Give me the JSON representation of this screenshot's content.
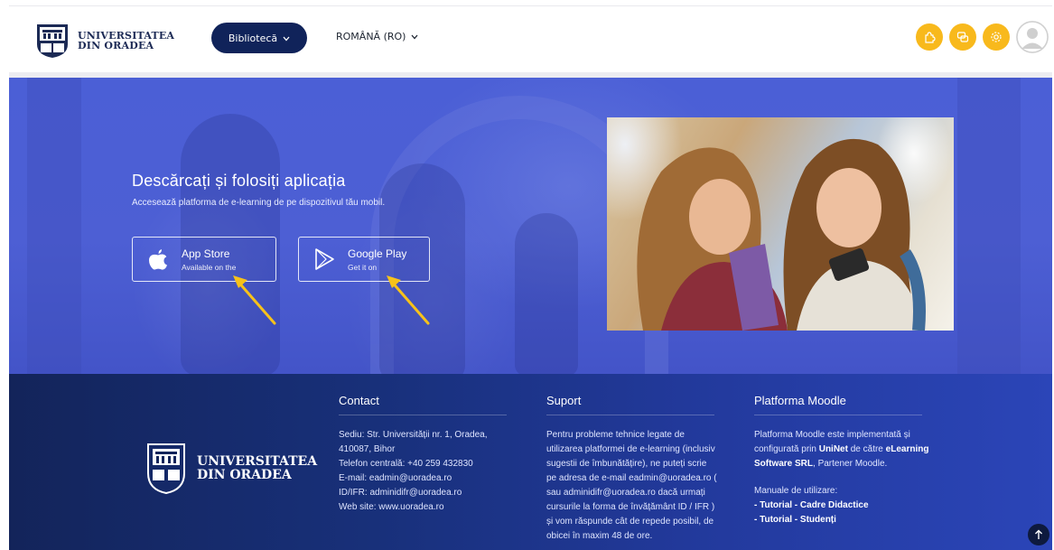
{
  "brand": {
    "line1": "UNIVERSITATEA",
    "line2": "DIN ORADEA"
  },
  "nav": {
    "library_label": "Bibliotecă",
    "language_label": "ROMÂNĂ (RO)",
    "icons": [
      "puzzle-icon",
      "chat-icon",
      "settings-icon"
    ],
    "accent_color": "#f8b91c",
    "nav_button_color": "#10235a"
  },
  "hero": {
    "title": "Descărcați și folosiți aplicația",
    "subtitle": "Accesează platforma de e-learning de pe dispozitivul tău mobil.",
    "app_store": {
      "name": "App Store",
      "small": "Available on the"
    },
    "google_play": {
      "name": "Google Play",
      "small": "Get it on"
    },
    "background_color": "#4b5fd6",
    "annotation_color": "#f7c21a"
  },
  "footer": {
    "logo_line1": "UNIVERSITATEA",
    "logo_line2": "DIN ORADEA",
    "contact": {
      "title": "Contact",
      "lines": [
        "Sediu: Str. Universității nr. 1, Oradea,",
        "410087, Bihor",
        "Telefon centrală: +40 259 432830",
        "E-mail: eadmin@uoradea.ro",
        "ID/IFR: adminidifr@uoradea.ro",
        "Web site: www.uoradea.ro"
      ]
    },
    "support": {
      "title": "Suport",
      "lines": [
        "Pentru probleme tehnice legate de",
        "utilizarea platformei de e-learning (inclusiv",
        "sugestii de îmbunătățire), ne puteți scrie",
        "pe adresa de e-mail eadmin@uoradea.ro (",
        "sau adminidifr@uoradea.ro dacă urmați",
        "cursurile la forma de învățământ ID / IFR )",
        "și vom răspunde cât de repede posibil, de",
        "obicei în maxim 48 de ore."
      ]
    },
    "moodle": {
      "title": "Platforma Moodle",
      "t1": "Platforma Moodle este implementată și",
      "t2": "configurată prin ",
      "t2b": "UniNet",
      "t3": " de către ",
      "t3b": "eLearning",
      "t4b": "Software SRL",
      "t5": ", Partener Moodle.",
      "manuals_label": "Manuale de utilizare:",
      "link1": "- Tutorial - Cadre Didactice",
      "link2": "- Tutorial - Studenți"
    }
  }
}
